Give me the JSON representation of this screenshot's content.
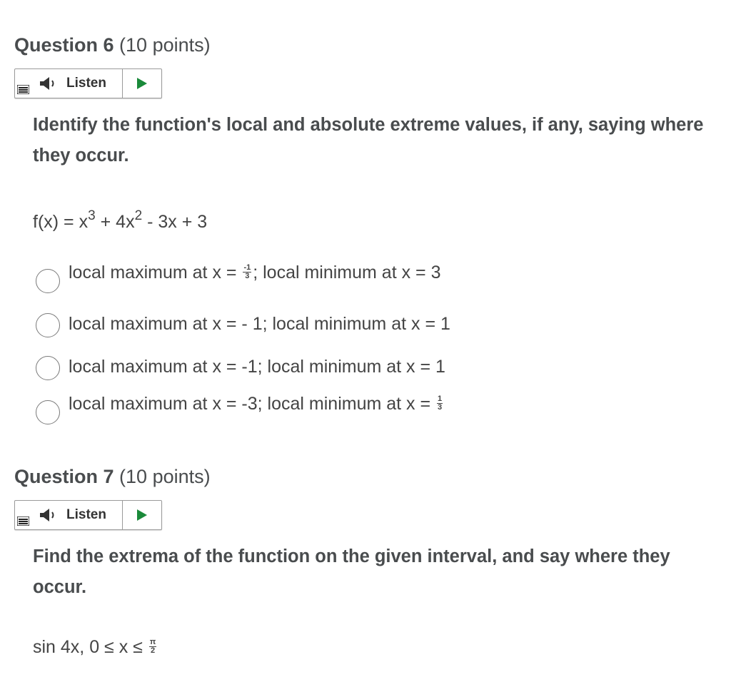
{
  "q6": {
    "title": "Question 6",
    "points": "(10 points)",
    "listen_label": "Listen",
    "prompt": "Identify the function's local and absolute extreme values, if any, saying where they occur.",
    "function": {
      "prefix": "f(x) = x",
      "exp1": "3",
      "mid": " + 4x",
      "exp2": "2",
      "suffix": " - 3x + 3"
    },
    "options": [
      {
        "before": "local maximum at x = ",
        "frac_num": "-1",
        "frac_den": "3",
        "after": "; local minimum at x = 3"
      },
      {
        "text": "local maximum at x = - 1; local minimum at x = 1"
      },
      {
        "text": "local maximum at x = -1; local minimum at x = 1"
      },
      {
        "before": "local maximum at x = -3; local minimum at x = ",
        "frac_num": "1",
        "frac_den": "3",
        "after": ""
      }
    ]
  },
  "q7": {
    "title": "Question 7",
    "points": "(10 points)",
    "listen_label": "Listen",
    "prompt": "Find the extrema of the function on the given interval, and say where they occur.",
    "function": {
      "before": "sin 4x, 0 ≤ x ≤ ",
      "frac_num": "π",
      "frac_den": "2"
    }
  },
  "colors": {
    "play": "#1a8a3a",
    "text": "#494c4e",
    "border": "#9a9a9a"
  },
  "icons": {
    "menu": "menu-icon",
    "speaker": "speaker-icon",
    "play": "play-icon"
  }
}
